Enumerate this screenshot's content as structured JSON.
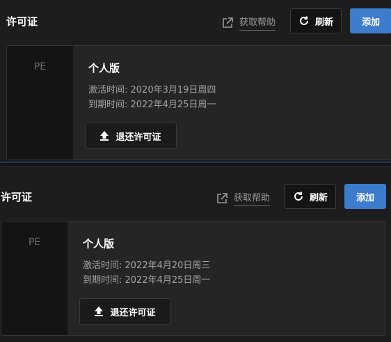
{
  "panels": [
    {
      "title": "许可证",
      "help_icon": "external-link-icon",
      "help_label": "获取帮助",
      "refresh_icon": "refresh-icon",
      "refresh_label": "刷新",
      "add_label": "添加",
      "license": {
        "edition_code": "PE",
        "edition_name": "个人版",
        "activated": "激活时间: 2020年3月19日周四",
        "expires": "到期时间: 2022年4月25日周一",
        "return_icon": "upload-icon",
        "return_label": "退还许可证"
      }
    },
    {
      "title": "许可证",
      "help_icon": "external-link-icon",
      "help_label": "获取帮助",
      "refresh_icon": "refresh-icon",
      "refresh_label": "刷新",
      "add_label": "添加",
      "license": {
        "edition_code": "PE",
        "edition_name": "个人版",
        "activated": "激活时间: 2022年4月20日周三",
        "expires": "到期时间: 2022年4月25日周一",
        "return_icon": "upload-icon",
        "return_label": "退还许可证"
      }
    }
  ],
  "colors": {
    "accent": "#3d7bcd",
    "background": "#1d1d1d",
    "card": "#252525"
  }
}
